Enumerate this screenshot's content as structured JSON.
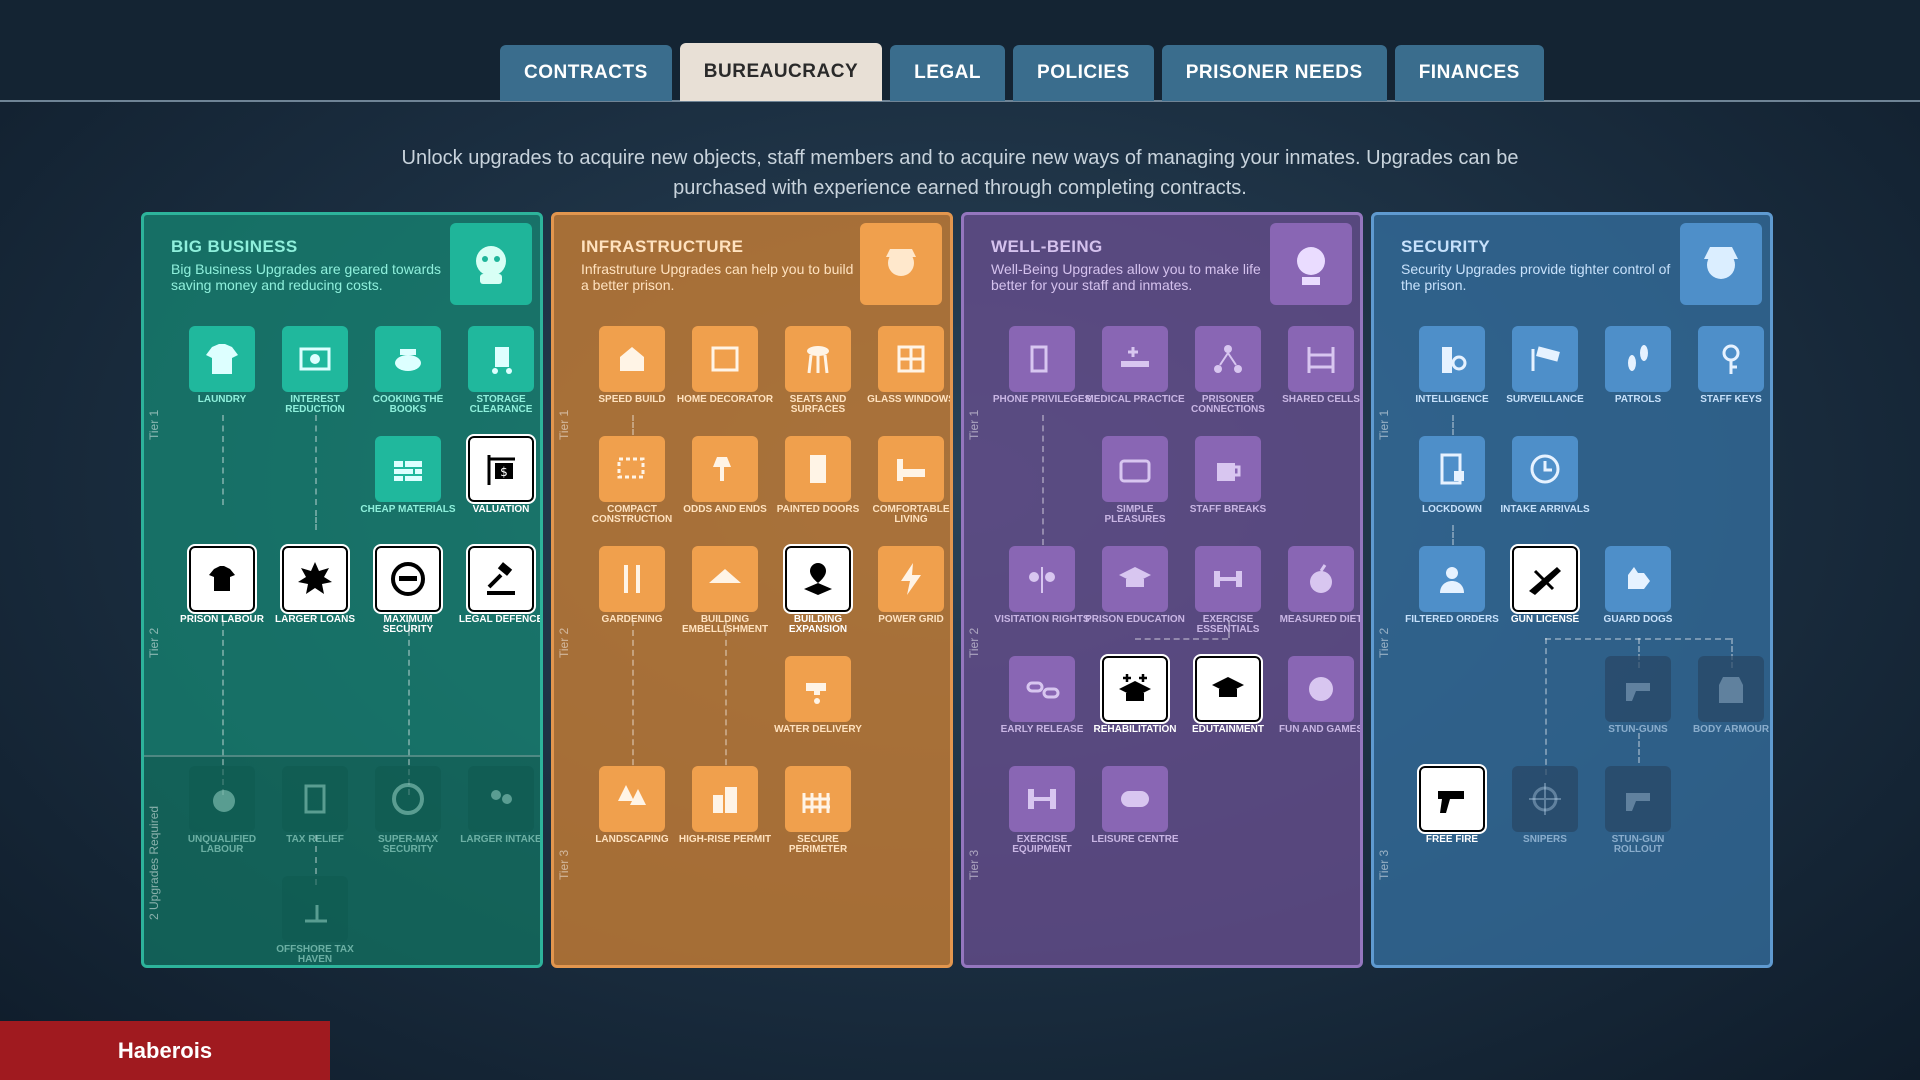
{
  "tabs": [
    "CONTRACTS",
    "BUREAUCRACY",
    "LEGAL",
    "POLICIES",
    "PRISONER NEEDS",
    "FINANCES"
  ],
  "intro": "Unlock upgrades to acquire new objects, staff members and to acquire new ways of managing your inmates. Upgrades can be purchased with experience earned through completing contracts.",
  "tier_labels": {
    "tier1": "Tier 1",
    "tier2": "Tier 2",
    "tier3": "Tier 3",
    "tier3_bb": "2 Upgrades Required"
  },
  "panels": {
    "big_business": {
      "title": "BIG BUSINESS",
      "desc": "Big Business Upgrades are geared towards saving money and reducing costs.",
      "nodes": [
        "LAUNDRY",
        "INTEREST REDUCTION",
        "COOKING THE BOOKS",
        "STORAGE CLEARANCE",
        "CHEAP MATERIALS",
        "VALUATION",
        "PRISON LABOUR",
        "LARGER LOANS",
        "MAXIMUM SECURITY",
        "LEGAL DEFENCE",
        "UNQUALIFIED LABOUR",
        "TAX RELIEF",
        "SUPER-MAX SECURITY",
        "LARGER INTAKE",
        "OFFSHORE TAX HAVEN"
      ]
    },
    "infrastructure": {
      "title": "INFRASTRUCTURE",
      "desc": "Infrastruture Upgrades can help you to build a better prison.",
      "nodes": [
        "SPEED BUILD",
        "HOME DECORATOR",
        "SEATS AND SURFACES",
        "GLASS WINDOWS",
        "COMPACT CONSTRUCTION",
        "ODDS AND ENDS",
        "PAINTED DOORS",
        "COMFORTABLE LIVING",
        "GARDENING",
        "BUILDING EMBELLISHMENT",
        "BUILDING EXPANSION",
        "POWER GRID",
        "WATER DELIVERY",
        "LANDSCAPING",
        "HIGH-RISE PERMIT",
        "SECURE PERIMETER"
      ]
    },
    "well_being": {
      "title": "WELL-BEING",
      "desc": "Well-Being Upgrades allow you to make life better for your staff and inmates.",
      "nodes": [
        "PHONE PRIVILEGES",
        "MEDICAL PRACTICE",
        "PRISONER CONNECTIONS",
        "SHARED CELLS",
        "SIMPLE PLEASURES",
        "STAFF BREAKS",
        "VISITATION RIGHTS",
        "PRISON EDUCATION",
        "EXERCISE ESSENTIALS",
        "MEASURED DIET",
        "EARLY RELEASE",
        "REHABILITATION",
        "EDUTAINMENT",
        "FUN AND GAMES",
        "EXERCISE EQUIPMENT",
        "LEISURE CENTRE"
      ]
    },
    "security": {
      "title": "SECURITY",
      "desc": "Security Upgrades provide tighter control of the prison.",
      "nodes": [
        "INTELLIGENCE",
        "SURVEILLANCE",
        "PATROLS",
        "STAFF KEYS",
        "LOCKDOWN",
        "INTAKE ARRIVALS",
        "FILTERED ORDERS",
        "GUN LICENSE",
        "GUARD DOGS",
        "STUN-GUNS",
        "BODY ARMOUR",
        "FREE FIRE",
        "SNIPERS",
        "STUN-GUN ROLLOUT"
      ]
    }
  },
  "player_name": "Haberois",
  "colors": {
    "big_business": "#20b89d",
    "infrastructure": "#f0a04d",
    "well_being": "#8966b4",
    "security": "#4e8fc9",
    "player_banner": "#a01a1f"
  }
}
